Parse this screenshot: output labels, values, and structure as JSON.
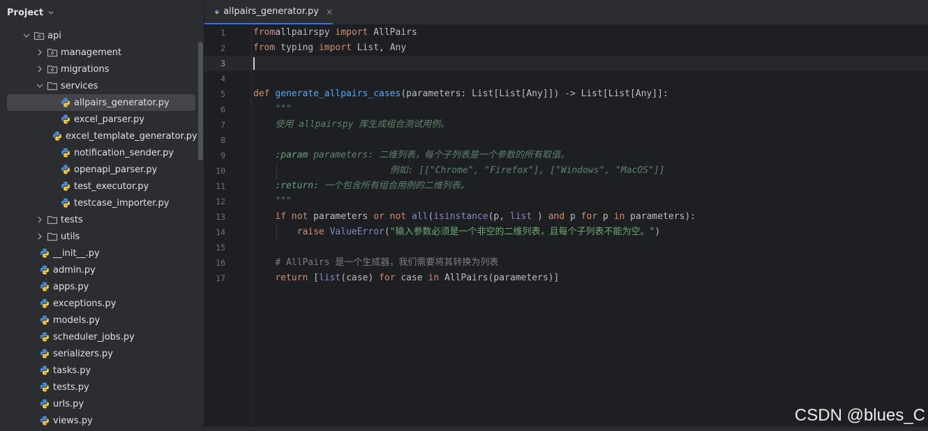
{
  "project_panel": {
    "title": "Project",
    "tree": [
      {
        "label": "api",
        "kind": "package",
        "level": 1,
        "expanded": true
      },
      {
        "label": "management",
        "kind": "package",
        "level": 2,
        "expanded": false
      },
      {
        "label": "migrations",
        "kind": "package",
        "level": 2,
        "expanded": false
      },
      {
        "label": "services",
        "kind": "folder",
        "level": 2,
        "expanded": true
      },
      {
        "label": "allpairs_generator.py",
        "kind": "python",
        "level": 3,
        "selected": true
      },
      {
        "label": "excel_parser.py",
        "kind": "python",
        "level": 3
      },
      {
        "label": "excel_template_generator.py",
        "kind": "python",
        "level": 3
      },
      {
        "label": "notification_sender.py",
        "kind": "python",
        "level": 3
      },
      {
        "label": "openapi_parser.py",
        "kind": "python",
        "level": 3
      },
      {
        "label": "test_executor.py",
        "kind": "python",
        "level": 3
      },
      {
        "label": "testcase_importer.py",
        "kind": "python",
        "level": 3
      },
      {
        "label": "tests",
        "kind": "folder",
        "level": 2,
        "expanded": false
      },
      {
        "label": "utils",
        "kind": "folder",
        "level": 2,
        "expanded": false
      },
      {
        "label": "__init__.py",
        "kind": "python",
        "level": 2
      },
      {
        "label": "admin.py",
        "kind": "python",
        "level": 2
      },
      {
        "label": "apps.py",
        "kind": "python",
        "level": 2
      },
      {
        "label": "exceptions.py",
        "kind": "python",
        "level": 2
      },
      {
        "label": "models.py",
        "kind": "python",
        "level": 2
      },
      {
        "label": "scheduler_jobs.py",
        "kind": "python",
        "level": 2
      },
      {
        "label": "serializers.py",
        "kind": "python",
        "level": 2
      },
      {
        "label": "tasks.py",
        "kind": "python",
        "level": 2
      },
      {
        "label": "tests.py",
        "kind": "python",
        "level": 2
      },
      {
        "label": "urls.py",
        "kind": "python",
        "level": 2
      },
      {
        "label": "views.py",
        "kind": "python",
        "level": 2
      }
    ]
  },
  "editor": {
    "tab_label": "allpairs_generator.py",
    "tab_close": "×",
    "current_line": 3,
    "lines": [
      {
        "n": "1",
        "tokens": [
          [
            "kw",
            "from"
          ],
          [
            "",
            "allpairspy "
          ],
          [
            "kw",
            "import"
          ],
          [
            "",
            " AllPairs"
          ]
        ]
      },
      {
        "n": "2",
        "tokens": [
          [
            "kw",
            "from"
          ],
          [
            "",
            " typing "
          ],
          [
            "kw",
            "import"
          ],
          [
            "",
            " List, Any"
          ]
        ]
      },
      {
        "n": "3",
        "tokens": []
      },
      {
        "n": "4",
        "tokens": []
      },
      {
        "n": "5",
        "tokens": [
          [
            "kw",
            "def "
          ],
          [
            "fn",
            "generate_allpairs_cases"
          ],
          [
            "",
            "(parameters: List[List[Any]]) -> List[List[Any]]:"
          ]
        ]
      },
      {
        "n": "6",
        "tokens": [
          [
            "",
            "    "
          ],
          [
            "doc",
            "\"\"\""
          ]
        ]
      },
      {
        "n": "7",
        "tokens": [
          [
            "",
            "    "
          ],
          [
            "doc",
            "使用 allpairspy 库生成组合测试用例。"
          ]
        ]
      },
      {
        "n": "8",
        "tokens": []
      },
      {
        "n": "9",
        "tokens": [
          [
            "",
            "    "
          ],
          [
            "doctag",
            ":param"
          ],
          [
            "doc",
            " parameters: 二维列表，每个子列表是一个参数的所有取值。"
          ]
        ]
      },
      {
        "n": "10",
        "tokens": [
          [
            "",
            "    "
          ],
          [
            "doc",
            "                     例如: [[\"Chrome\", \"Firefox\"], [\"Windows\", \"MacOS\"]]"
          ]
        ]
      },
      {
        "n": "11",
        "tokens": [
          [
            "",
            "    "
          ],
          [
            "doctag",
            ":return:"
          ],
          [
            "doc",
            " 一个包含所有组合用例的二维列表。"
          ]
        ]
      },
      {
        "n": "12",
        "tokens": [
          [
            "",
            "    "
          ],
          [
            "doc",
            "\"\"\""
          ]
        ]
      },
      {
        "n": "13",
        "tokens": [
          [
            "",
            "    "
          ],
          [
            "kw",
            "if not "
          ],
          [
            "",
            "parameters "
          ],
          [
            "kw",
            "or not "
          ],
          [
            "bi",
            "all"
          ],
          [
            "",
            "("
          ],
          [
            "bi",
            "isinstance"
          ],
          [
            "",
            "(p, "
          ],
          [
            "bi",
            "list"
          ],
          [
            "",
            " ) "
          ],
          [
            "kw",
            "and "
          ],
          [
            "",
            "p "
          ],
          [
            "kw",
            "for "
          ],
          [
            "",
            "p "
          ],
          [
            "kw",
            "in "
          ],
          [
            "",
            "parameters):"
          ]
        ]
      },
      {
        "n": "14",
        "tokens": [
          [
            "",
            "        "
          ],
          [
            "kw",
            "raise "
          ],
          [
            "bi",
            "ValueError"
          ],
          [
            "",
            "("
          ],
          [
            "str",
            "\"输入参数必须是一个非空的二维列表，且每个子列表不能为空。\""
          ],
          [
            "",
            ")"
          ]
        ]
      },
      {
        "n": "15",
        "tokens": []
      },
      {
        "n": "16",
        "tokens": [
          [
            "",
            "    "
          ],
          [
            "cmt",
            "# AllPairs 是一个生成器，我们需要将其转换为列表"
          ]
        ]
      },
      {
        "n": "17",
        "tokens": [
          [
            "",
            "    "
          ],
          [
            "kw",
            "return "
          ],
          [
            "",
            "["
          ],
          [
            "bi",
            "list"
          ],
          [
            "",
            "(case) "
          ],
          [
            "kw",
            "for "
          ],
          [
            "",
            "case "
          ],
          [
            "kw",
            "in "
          ],
          [
            "",
            "AllPairs(parameters)]"
          ]
        ]
      }
    ]
  },
  "watermark": "CSDN @blues_C",
  "icons": {
    "folder": "folder-icon",
    "package": "package-folder-icon",
    "python": "python-file-icon",
    "chevron": "chevron-icon"
  },
  "colors": {
    "background": "#1e1f22",
    "panel": "#2b2d30",
    "accent": "#3574f0",
    "keyword": "#cf8e6d",
    "function": "#56a8f5",
    "string": "#6aab73",
    "docstring": "#5f826b"
  }
}
